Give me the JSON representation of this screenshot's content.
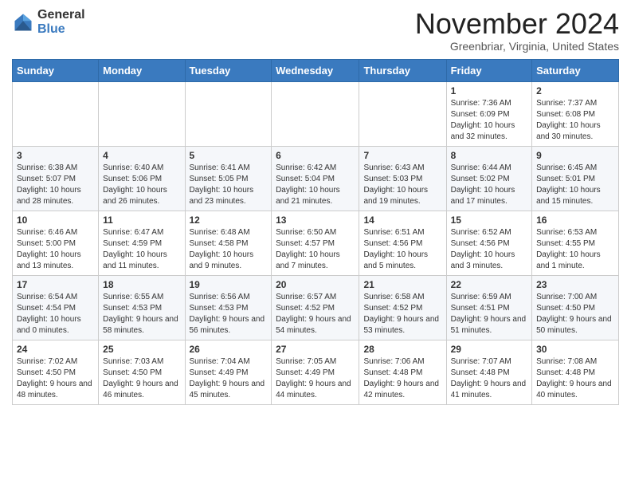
{
  "header": {
    "logo_general": "General",
    "logo_blue": "Blue",
    "month_title": "November 2024",
    "location": "Greenbriar, Virginia, United States"
  },
  "weekdays": [
    "Sunday",
    "Monday",
    "Tuesday",
    "Wednesday",
    "Thursday",
    "Friday",
    "Saturday"
  ],
  "weeks": [
    [
      {
        "day": "",
        "info": ""
      },
      {
        "day": "",
        "info": ""
      },
      {
        "day": "",
        "info": ""
      },
      {
        "day": "",
        "info": ""
      },
      {
        "day": "",
        "info": ""
      },
      {
        "day": "1",
        "info": "Sunrise: 7:36 AM\nSunset: 6:09 PM\nDaylight: 10 hours and 32 minutes."
      },
      {
        "day": "2",
        "info": "Sunrise: 7:37 AM\nSunset: 6:08 PM\nDaylight: 10 hours and 30 minutes."
      }
    ],
    [
      {
        "day": "3",
        "info": "Sunrise: 6:38 AM\nSunset: 5:07 PM\nDaylight: 10 hours and 28 minutes."
      },
      {
        "day": "4",
        "info": "Sunrise: 6:40 AM\nSunset: 5:06 PM\nDaylight: 10 hours and 26 minutes."
      },
      {
        "day": "5",
        "info": "Sunrise: 6:41 AM\nSunset: 5:05 PM\nDaylight: 10 hours and 23 minutes."
      },
      {
        "day": "6",
        "info": "Sunrise: 6:42 AM\nSunset: 5:04 PM\nDaylight: 10 hours and 21 minutes."
      },
      {
        "day": "7",
        "info": "Sunrise: 6:43 AM\nSunset: 5:03 PM\nDaylight: 10 hours and 19 minutes."
      },
      {
        "day": "8",
        "info": "Sunrise: 6:44 AM\nSunset: 5:02 PM\nDaylight: 10 hours and 17 minutes."
      },
      {
        "day": "9",
        "info": "Sunrise: 6:45 AM\nSunset: 5:01 PM\nDaylight: 10 hours and 15 minutes."
      }
    ],
    [
      {
        "day": "10",
        "info": "Sunrise: 6:46 AM\nSunset: 5:00 PM\nDaylight: 10 hours and 13 minutes."
      },
      {
        "day": "11",
        "info": "Sunrise: 6:47 AM\nSunset: 4:59 PM\nDaylight: 10 hours and 11 minutes."
      },
      {
        "day": "12",
        "info": "Sunrise: 6:48 AM\nSunset: 4:58 PM\nDaylight: 10 hours and 9 minutes."
      },
      {
        "day": "13",
        "info": "Sunrise: 6:50 AM\nSunset: 4:57 PM\nDaylight: 10 hours and 7 minutes."
      },
      {
        "day": "14",
        "info": "Sunrise: 6:51 AM\nSunset: 4:56 PM\nDaylight: 10 hours and 5 minutes."
      },
      {
        "day": "15",
        "info": "Sunrise: 6:52 AM\nSunset: 4:56 PM\nDaylight: 10 hours and 3 minutes."
      },
      {
        "day": "16",
        "info": "Sunrise: 6:53 AM\nSunset: 4:55 PM\nDaylight: 10 hours and 1 minute."
      }
    ],
    [
      {
        "day": "17",
        "info": "Sunrise: 6:54 AM\nSunset: 4:54 PM\nDaylight: 10 hours and 0 minutes."
      },
      {
        "day": "18",
        "info": "Sunrise: 6:55 AM\nSunset: 4:53 PM\nDaylight: 9 hours and 58 minutes."
      },
      {
        "day": "19",
        "info": "Sunrise: 6:56 AM\nSunset: 4:53 PM\nDaylight: 9 hours and 56 minutes."
      },
      {
        "day": "20",
        "info": "Sunrise: 6:57 AM\nSunset: 4:52 PM\nDaylight: 9 hours and 54 minutes."
      },
      {
        "day": "21",
        "info": "Sunrise: 6:58 AM\nSunset: 4:52 PM\nDaylight: 9 hours and 53 minutes."
      },
      {
        "day": "22",
        "info": "Sunrise: 6:59 AM\nSunset: 4:51 PM\nDaylight: 9 hours and 51 minutes."
      },
      {
        "day": "23",
        "info": "Sunrise: 7:00 AM\nSunset: 4:50 PM\nDaylight: 9 hours and 50 minutes."
      }
    ],
    [
      {
        "day": "24",
        "info": "Sunrise: 7:02 AM\nSunset: 4:50 PM\nDaylight: 9 hours and 48 minutes."
      },
      {
        "day": "25",
        "info": "Sunrise: 7:03 AM\nSunset: 4:50 PM\nDaylight: 9 hours and 46 minutes."
      },
      {
        "day": "26",
        "info": "Sunrise: 7:04 AM\nSunset: 4:49 PM\nDaylight: 9 hours and 45 minutes."
      },
      {
        "day": "27",
        "info": "Sunrise: 7:05 AM\nSunset: 4:49 PM\nDaylight: 9 hours and 44 minutes."
      },
      {
        "day": "28",
        "info": "Sunrise: 7:06 AM\nSunset: 4:48 PM\nDaylight: 9 hours and 42 minutes."
      },
      {
        "day": "29",
        "info": "Sunrise: 7:07 AM\nSunset: 4:48 PM\nDaylight: 9 hours and 41 minutes."
      },
      {
        "day": "30",
        "info": "Sunrise: 7:08 AM\nSunset: 4:48 PM\nDaylight: 9 hours and 40 minutes."
      }
    ]
  ]
}
